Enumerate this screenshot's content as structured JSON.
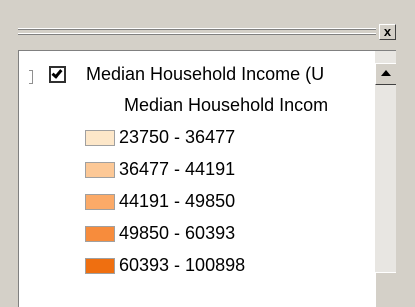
{
  "panel": {
    "close_label": "x"
  },
  "layer": {
    "checked": true,
    "name": "Median Household Income (U",
    "field": "Median Household Incom"
  },
  "legend": [
    {
      "label": "23750 - 36477",
      "color": "#fde7c9"
    },
    {
      "label": "36477 - 44191",
      "color": "#fcc896"
    },
    {
      "label": "44191 - 49850",
      "color": "#fbaa68"
    },
    {
      "label": "49850 - 60393",
      "color": "#f78c3c"
    },
    {
      "label": "60393 - 100898",
      "color": "#ef6f10"
    }
  ],
  "icons": {
    "close": "close-icon",
    "check": "check-icon",
    "scroll_up": "arrow-up-icon"
  }
}
